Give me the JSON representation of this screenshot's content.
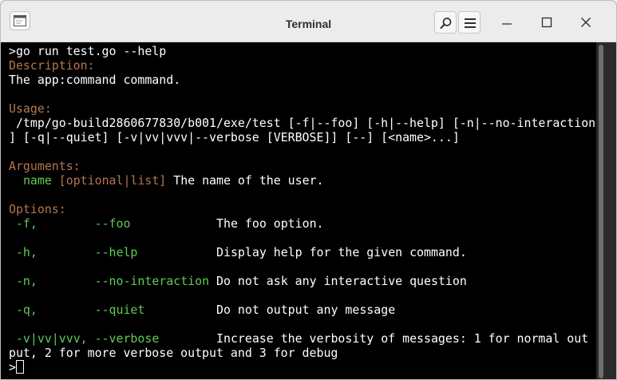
{
  "window": {
    "title": "Terminal"
  },
  "terminal": {
    "prompt_command": ">go run test.go --help",
    "description_label": "Description:",
    "description_text": "The app:command command.",
    "usage_label": "Usage:",
    "usage_line1": " /tmp/go-build2860677830/b001/exe/test [-f|--foo] [-h|--help] [-n|--no-interaction",
    "usage_line2": "] [-q|--quiet] [-v|vv|vvv|--verbose [VERBOSE]] [--] [<name>...]",
    "arguments_label": "Arguments:",
    "argument_name": "name",
    "argument_qualifier": "[optional|list]",
    "argument_desc": "The name of the user.",
    "options_label": "Options:",
    "options": [
      {
        "short": "-f,",
        "long": "--foo",
        "desc": "The foo option."
      },
      {
        "short": "-h,",
        "long": "--help",
        "desc": "Display help for the given command."
      },
      {
        "short": "-n,",
        "long": "--no-interaction",
        "desc": "Do not ask any interactive question"
      },
      {
        "short": "-q,",
        "long": "--quiet",
        "desc": "Do not output any message"
      },
      {
        "short": "-v|vv|vvv,",
        "long": "--verbose",
        "desc": "Increase the verbosity of messages: 1 for normal out"
      }
    ],
    "verbose_wrap": "put, 2 for more verbose output and 3 for debug",
    "final_prompt": ">"
  },
  "colors": {
    "label": "#b5764e",
    "option": "#5ccc56",
    "text": "#ffffff",
    "background": "#000000"
  },
  "icons": [
    "terminal-app-icon",
    "search-icon",
    "hamburger-menu-icon",
    "minimize-icon",
    "maximize-icon",
    "close-icon"
  ]
}
